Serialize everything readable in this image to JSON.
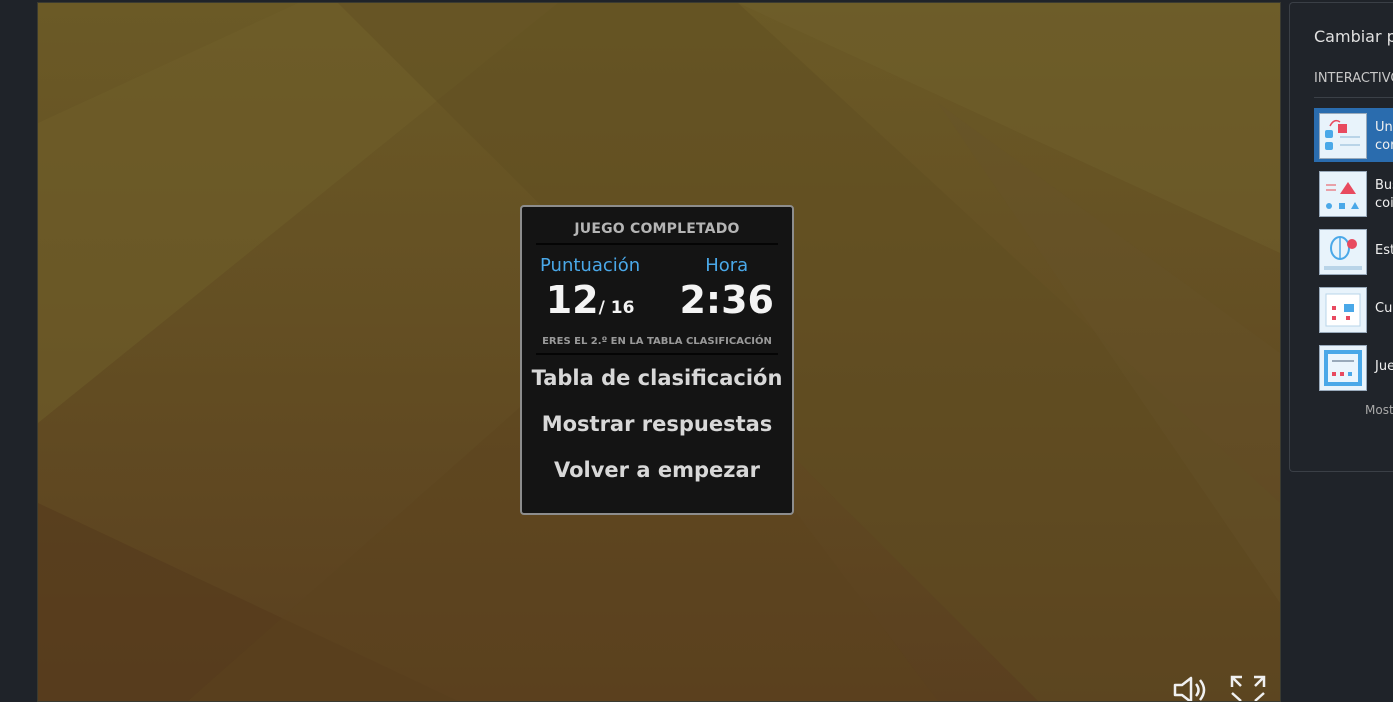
{
  "result": {
    "title": "JUEGO COMPLETADO",
    "score_label": "Puntuación",
    "score_value": "12",
    "score_total": "/ 16",
    "time_label": "Hora",
    "time_value": "2:36",
    "rank_text": "ERES EL 2.º EN LA TABLA CLASIFICACIÓN",
    "buttons": [
      "Tabla de clasificación",
      "Mostrar respuestas",
      "Volver a empezar"
    ]
  },
  "controls": {
    "sound_icon": "speaker-icon",
    "fullscreen_icon": "fullscreen-icon"
  },
  "sidebar": {
    "title": "Cambiar pl",
    "section": "INTERACTIVO",
    "items": [
      {
        "line1": "Un",
        "line2": "cor",
        "active": true
      },
      {
        "line1": "Bus",
        "line2": "coi",
        "active": false
      },
      {
        "line1": "Est",
        "line2": "",
        "active": false
      },
      {
        "line1": "Cue",
        "line2": "",
        "active": false
      },
      {
        "line1": "Jue",
        "line2": "",
        "active": false
      }
    ],
    "more": "Most"
  },
  "colors": {
    "accent": "#4aa8e8",
    "active_item": "#2a6cae",
    "card_bg": "#141414",
    "game_bg": "#644f23"
  }
}
